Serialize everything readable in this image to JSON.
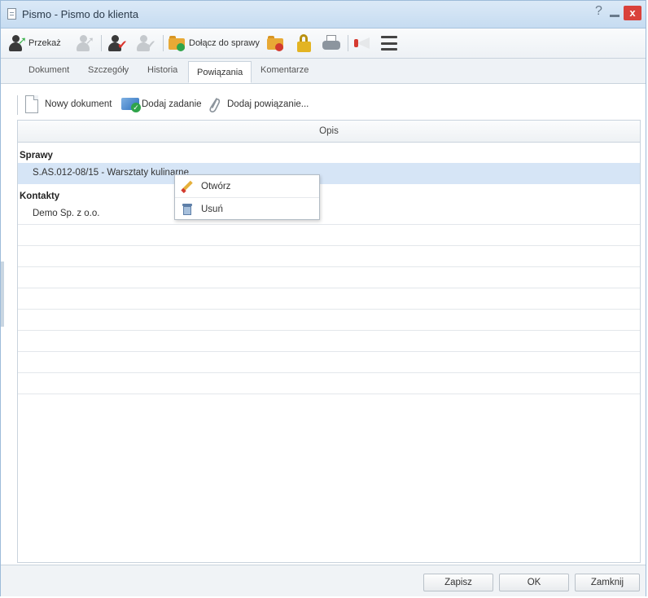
{
  "window": {
    "title": "Pismo - Pismo do klienta",
    "help_glyph": "?",
    "close_glyph": "x"
  },
  "toolbar": {
    "przekaz_label": "Przekaż",
    "dolacz_label": "Dołącz do sprawy"
  },
  "tabs": [
    {
      "label": "Dokument"
    },
    {
      "label": "Szczegóły"
    },
    {
      "label": "Historia"
    },
    {
      "label": "Powiązania",
      "active": true
    },
    {
      "label": "Komentarze"
    }
  ],
  "actions": {
    "new_document": "Nowy dokument",
    "add_task": "Dodaj zadanie",
    "add_link": "Dodaj powiązanie..."
  },
  "grid": {
    "column_header": "Opis",
    "groups": [
      {
        "title": "Sprawy",
        "rows": [
          "S.AS.012-08/15 - Warsztaty kulinarne"
        ]
      },
      {
        "title": "Kontakty",
        "rows": [
          "Demo Sp. z o.o."
        ]
      }
    ]
  },
  "context_menu": {
    "items": [
      {
        "label": "Otwórz",
        "icon": "pencil-icon"
      },
      {
        "label": "Usuń",
        "icon": "trash-icon"
      }
    ]
  },
  "footer": {
    "save": "Zapisz",
    "ok": "OK",
    "close": "Zamknij"
  },
  "colors": {
    "selection": "#d6e5f6",
    "close_button": "#d9413b",
    "title_bar": "#c6dcf1"
  }
}
